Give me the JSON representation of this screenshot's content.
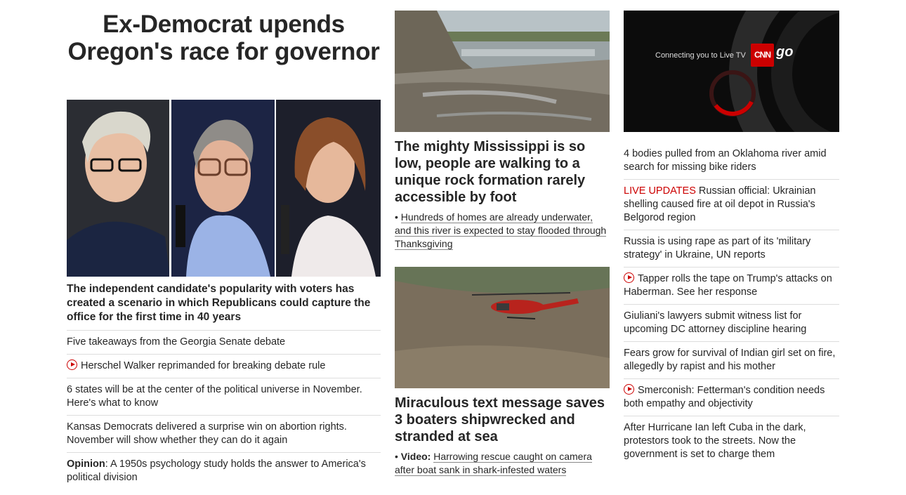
{
  "main": {
    "headline": "Ex-Democrat upends Oregon's race for governor",
    "lead_text": "The independent candidate's popularity with voters has created a scenario in which Republicans could capture the office for the first time in 40 years",
    "items": [
      {
        "text": "Five takeaways from the Georgia Senate debate",
        "video": false
      },
      {
        "text": "Herschel Walker reprimanded for breaking debate rule",
        "video": true
      },
      {
        "text": "6 states will be at the center of the political universe in November. Here's what to know",
        "video": false
      },
      {
        "text": "Kansas Democrats delivered a surprise win on abortion rights. November will show whether they can do it again",
        "video": false
      }
    ],
    "opinion_label": "Opinion",
    "opinion_text": ": A 1950s psychology study holds the answer to America's political division"
  },
  "middle": {
    "card1": {
      "title": "The mighty Mississippi is so low, people are walking to a unique rock formation rarely accessible by foot",
      "bullet": "•",
      "sub": "Hundreds of homes are already underwater, and this river is expected to stay flooded through Thanksgiving"
    },
    "card2": {
      "title": "Miraculous text message saves 3 boaters shipwrecked and stranded at sea",
      "bullet": "•",
      "video_label": "Video:",
      "sub": "Harrowing rescue caught on camera after boat sank in shark-infested waters"
    }
  },
  "right": {
    "live_tv": {
      "connecting": "Connecting you to Live TV",
      "logo": "CNN",
      "go": "go"
    },
    "items": [
      {
        "prefix": "",
        "text": "4 bodies pulled from an Oklahoma river amid search for missing bike riders",
        "video": false
      },
      {
        "prefix": "LIVE UPDATES",
        "text": " Russian official: Ukrainian shelling caused fire at oil depot in Russia's Belgorod region",
        "video": false
      },
      {
        "prefix": "",
        "text": "Russia is using rape as part of its 'military strategy' in Ukraine, UN reports",
        "video": false
      },
      {
        "prefix": "",
        "text": "Tapper rolls the tape on Trump's attacks on Haberman. See her response",
        "video": true
      },
      {
        "prefix": "",
        "text": "Giuliani's lawyers submit witness list for upcoming DC attorney discipline hearing",
        "video": false
      },
      {
        "prefix": "",
        "text": "Fears grow for survival of Indian girl set on fire, allegedly by rapist and his mother",
        "video": false
      },
      {
        "prefix": "",
        "text": "Smerconish: Fetterman's condition needs both empathy and objectivity",
        "video": true
      },
      {
        "prefix": "",
        "text": "After Hurricane Ian left Cuba in the dark, protestors took to the streets. Now the government is set to charge them",
        "video": false
      }
    ]
  },
  "colors": {
    "accent": "#cc0000",
    "text": "#262626",
    "divider": "#dddddd"
  }
}
